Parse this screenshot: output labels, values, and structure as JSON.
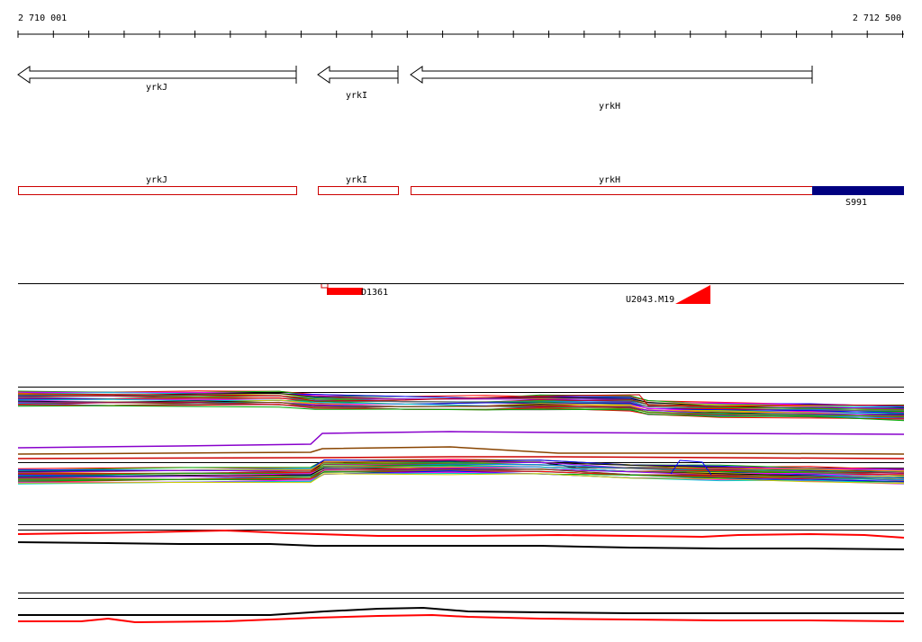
{
  "coordinates": {
    "start": "2 710 001",
    "end": "2 712 500"
  },
  "genes": [
    {
      "id": "gene-yrkj",
      "name": "yrkJ"
    },
    {
      "id": "gene-yrki",
      "name": "yrkI"
    },
    {
      "id": "gene-yrkh",
      "name": "yrkH"
    }
  ],
  "segments": [
    {
      "id": "seg-yrkj",
      "name": "yrkJ"
    },
    {
      "id": "seg-yrki",
      "name": "yrkI"
    },
    {
      "id": "seg-yrkh",
      "name": "yrkH"
    },
    {
      "id": "seg-s991",
      "name": "S991"
    }
  ],
  "features": [
    {
      "id": "feature-d1361",
      "name": "D1361"
    },
    {
      "id": "feature-u2043",
      "name": "U2043.M19"
    }
  ],
  "colors": {
    "axis": "#000000",
    "gene_outline": "#000000",
    "segment_outline": "#cc0000",
    "segment_fill_s991": "#000080",
    "feature_fill": "#ff0000"
  }
}
